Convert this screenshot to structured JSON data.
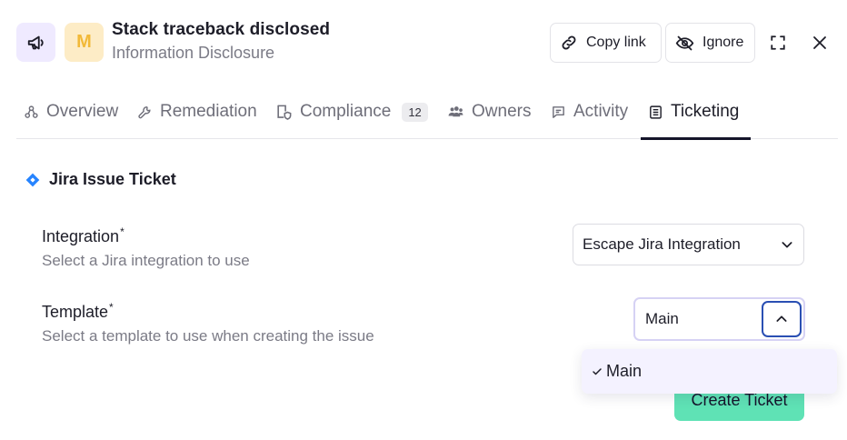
{
  "header": {
    "severity_letter": "M",
    "title": "Stack traceback disclosed",
    "category": "Information Disclosure",
    "copy_link_label": "Copy link",
    "ignore_label": "Ignore"
  },
  "tabs": [
    {
      "label": "Overview",
      "icon": "hierarchy-icon",
      "active": false
    },
    {
      "label": "Remediation",
      "icon": "wrench-icon",
      "active": false
    },
    {
      "label": "Compliance",
      "icon": "compliance-shield-icon",
      "count": "12",
      "active": false
    },
    {
      "label": "Owners",
      "icon": "users-icon",
      "active": false
    },
    {
      "label": "Activity",
      "icon": "comment-icon",
      "active": false
    },
    {
      "label": "Ticketing",
      "icon": "ticket-list-icon",
      "active": true
    }
  ],
  "section": {
    "title": "Jira Issue Ticket"
  },
  "integration": {
    "label": "Integration",
    "required_mark": "*",
    "help": "Select a Jira integration to use",
    "value": "Escape Jira Integration"
  },
  "template": {
    "label": "Template",
    "required_mark": "*",
    "help": "Select a template to use when creating the issue",
    "value": "Main",
    "options": [
      {
        "label": "Main",
        "selected": true
      }
    ]
  },
  "actions": {
    "create_label": "Create Ticket"
  },
  "colors": {
    "accent": "#5fe2b5",
    "focus": "#2a4fb3",
    "jira": "#2684ff",
    "severity_medium": "#f2b938"
  }
}
